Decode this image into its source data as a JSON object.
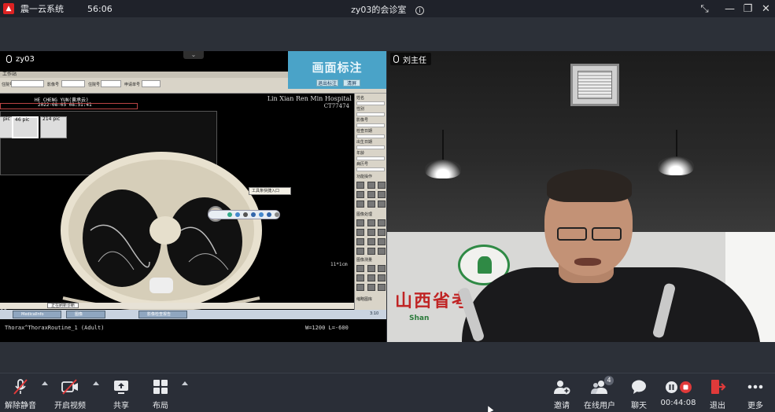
{
  "titlebar": {
    "app_name": "震一云系统",
    "timer": "56:06",
    "room_title": "zy03的会诊室",
    "info_icon": "info-icon",
    "controls": [
      "shrink-icon",
      "minimize-icon",
      "restore-icon",
      "close-icon"
    ]
  },
  "left_tile": {
    "name": "zy03",
    "annotation_banner": {
      "title": "画面标注",
      "btn_left": "退出标注",
      "btn_right": "清屏"
    },
    "ct_viewer": {
      "menu_text": "工作站",
      "id_label": "住院号",
      "field_labels": [
        "影像号",
        "住院号",
        "申请单号"
      ],
      "patient_line": "HE CHENG YUN(黄承云)",
      "date_line": "2022-08-05 08:51:41",
      "hospital": "Lin Xian Ren Min Hospital",
      "hospital_sub": "CT77474",
      "thumbs": [
        "pic",
        "46 pic",
        "214 pic"
      ],
      "popup": "工具条快捷入口",
      "scale": "11*1cm",
      "footer": "Thorax^ThoraxRoutine_1 (Adult)",
      "window_level": "W=1200 L=-600",
      "side_num": "00",
      "taskbar_status": "正在刷新诊断",
      "task_items": [
        "MedicalInfo",
        "图像",
        "影像检查报告"
      ],
      "task_status_right": "3:10",
      "right_panel": [
        "姓名",
        "性别",
        "影像号",
        "检查日期",
        "出生日期",
        "年龄",
        "病历号"
      ],
      "right_panel_section": "功能操作",
      "right_panel_section2": "图像处理",
      "right_panel_section3": "图像测量",
      "right_panel_bottom": "缩略图库"
    }
  },
  "right_tile": {
    "name": "刘主任",
    "wall_text": "山西省考",
    "wall_sub": "Shan"
  },
  "toolbar": {
    "unmute": "解除静音",
    "start_video": "开启视频",
    "share": "共享",
    "layout": "布局",
    "invite": "邀请",
    "online_users": "在线用户",
    "online_count": "4",
    "chat": "聊天",
    "record_time": "00:44:08",
    "exit": "退出",
    "more": "更多"
  },
  "colors": {
    "accent_red": "#e03a3a",
    "annot_blue": "#4aa3c8",
    "toolbar_bg": "#2a2e37"
  }
}
